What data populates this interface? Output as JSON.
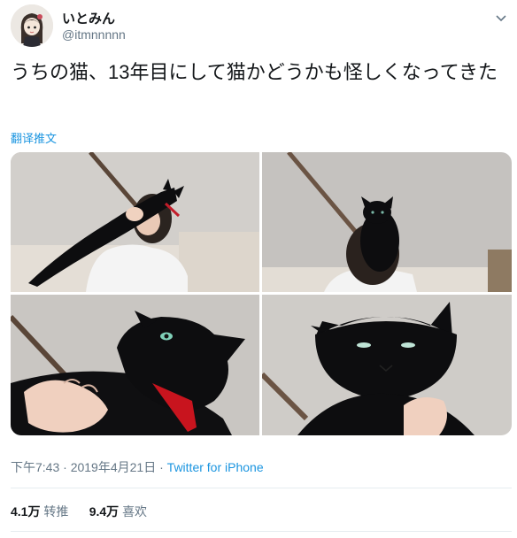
{
  "user": {
    "display_name": "いとみん",
    "handle": "@itmnnnnn"
  },
  "tweet": {
    "text": "うちの猫、13年目にして猫かどうかも怪しくなってきた",
    "translate_label": "翻译推文"
  },
  "meta": {
    "time": "下午7:43",
    "sep1": " · ",
    "date": "2019年4月21日",
    "sep2": " · ",
    "source": "Twitter for iPhone"
  },
  "stats": {
    "retweets_count": "4.1万",
    "retweets_label": "转推",
    "likes_count": "9.4万",
    "likes_label": "喜欢"
  },
  "icons": {
    "menu": "chevron-down-icon"
  }
}
